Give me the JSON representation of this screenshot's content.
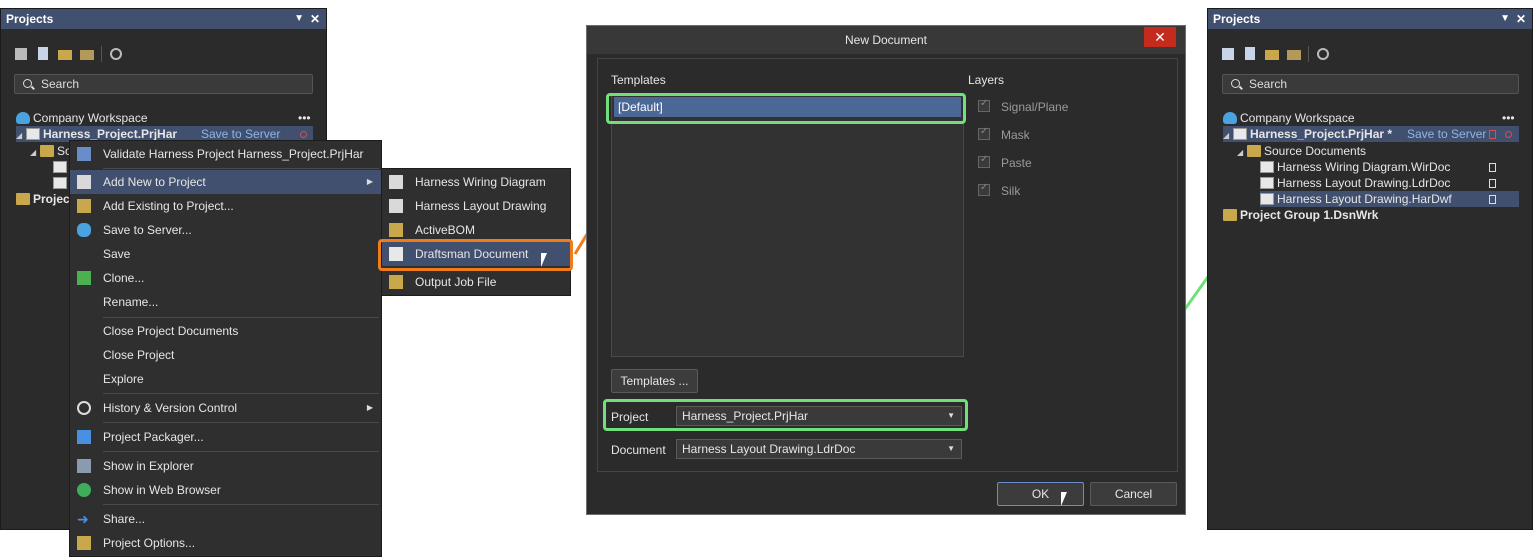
{
  "left_panel": {
    "title": "Projects",
    "search_placeholder": "Search",
    "tree": {
      "workspace": "Company Workspace",
      "more": "•••",
      "project": "Harness_Project.PrjHar",
      "save_to_server": "Save to Server",
      "source_docs_partial": "So",
      "project_group_partial": "Project"
    }
  },
  "context_menu": {
    "items": [
      {
        "label": "Validate Harness Project Harness_Project.PrjHar"
      },
      {
        "label": "Add New to Project",
        "highlighted": true,
        "submenu": true
      },
      {
        "label": "Add Existing to Project..."
      },
      {
        "label": "Save to Server..."
      },
      {
        "label": "Save"
      },
      {
        "label": "Clone..."
      },
      {
        "label": "Rename..."
      },
      {
        "label": "Close Project Documents"
      },
      {
        "label": "Close Project"
      },
      {
        "label": "Explore"
      },
      {
        "label": "History & Version Control",
        "submenu": true
      },
      {
        "label": "Project Packager..."
      },
      {
        "label": "Show in Explorer"
      },
      {
        "label": "Show in Web Browser"
      },
      {
        "label": "Share..."
      },
      {
        "label": "Project Options..."
      }
    ]
  },
  "submenu": {
    "items": [
      {
        "label": "Harness Wiring Diagram"
      },
      {
        "label": "Harness Layout Drawing"
      },
      {
        "label": "ActiveBOM"
      },
      {
        "label": "Draftsman Document",
        "highlighted": true
      },
      {
        "label": "Output Job File"
      }
    ]
  },
  "dialog": {
    "title": "New Document",
    "close": "✕",
    "templates_label": "Templates",
    "template_selected": "[Default]",
    "layers_label": "Layers",
    "layers": [
      "Signal/Plane",
      "Mask",
      "Paste",
      "Silk"
    ],
    "templates_button": "Templates ...",
    "project_label": "Project",
    "project_value": "Harness_Project.PrjHar",
    "document_label": "Document",
    "document_value": "Harness Layout Drawing.LdrDoc",
    "ok": "OK",
    "cancel": "Cancel"
  },
  "right_panel": {
    "title": "Projects",
    "search_placeholder": "Search",
    "tree": {
      "workspace": "Company Workspace",
      "more": "•••",
      "project": "Harness_Project.PrjHar *",
      "save_to_server": "Save to Server",
      "source_docs": "Source Documents",
      "doc1": "Harness Wiring Diagram.WirDoc",
      "doc2": "Harness Layout Drawing.LdrDoc",
      "doc3": "Harness Layout Drawing.HarDwf",
      "group": "Project Group 1.DsnWrk"
    }
  },
  "colors": {
    "highlight_green": "#6fe07a",
    "highlight_orange": "#f07d1a",
    "selection": "#40506e",
    "close_red": "#c42b1c"
  }
}
